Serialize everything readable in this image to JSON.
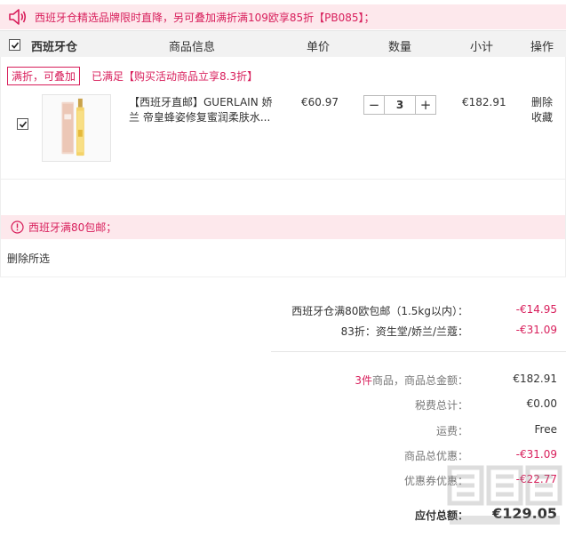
{
  "notice": {
    "text": "西班牙仓精选品牌限时直降，另可叠加满折满109欧享85折【PB085】；"
  },
  "header": {
    "store": "西班牙仓",
    "col_info": "商品信息",
    "col_price": "单价",
    "col_qty": "数量",
    "col_subtotal": "小计",
    "col_op": "操作"
  },
  "promo": {
    "tag": "满折，可叠加",
    "text": "已满足【购买活动商品立享8.3折】"
  },
  "item": {
    "title_line1": "【西班牙直邮】GUERLAIN 娇",
    "title_line2": "兰 帝皇蜂姿修复蜜润柔肤水...",
    "price": "€60.97",
    "qty": "3",
    "minus": "−",
    "plus": "+",
    "subtotal": "€182.91",
    "delete": "删除",
    "favorite": "收藏"
  },
  "shipping_bar": {
    "text": "西班牙满80包邮；"
  },
  "delete_selected": "删除所选",
  "discounts": [
    {
      "label": "西班牙仓满80欧包邮（1.5kg以内）：",
      "value": "-€14.95"
    },
    {
      "label": "83折：资生堂/娇兰/兰蔻：",
      "value": "-€31.09"
    }
  ],
  "summary": {
    "count_prefix": "3件",
    "count_suffix": "商品，商品总金额：",
    "goods_total": "€182.91",
    "tax_label": "税费总计：",
    "tax": "€0.00",
    "shipping_label": "运费：",
    "shipping": "Free",
    "discount_label": "商品总优惠：",
    "discount": "-€31.09",
    "coupon_label": "优惠券优惠：",
    "coupon": "-€22.77",
    "payable_label": "应付总额：",
    "payable": "€129.05"
  },
  "colors": {
    "accent": "#d81e5b",
    "notice_bg": "#fde8ec",
    "header_bg": "#f2f2f2"
  }
}
